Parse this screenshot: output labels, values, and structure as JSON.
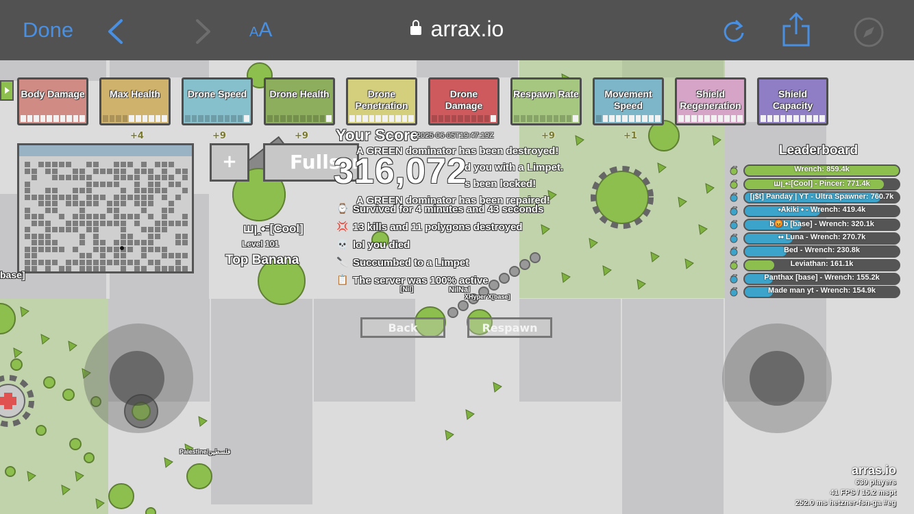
{
  "browser": {
    "done_label": "Done",
    "text_size_label_small": "A",
    "text_size_label_large": "A",
    "url": "arrax.io"
  },
  "upgrades": [
    {
      "label": "Body Damage",
      "color": "#d08b84",
      "filled": 0
    },
    {
      "label": "Max Health",
      "color": "#cfb26b",
      "filled": 4,
      "bonus": "+4"
    },
    {
      "label": "Drone Speed",
      "color": "#86c0cc",
      "filled": 9,
      "bonus": "+9"
    },
    {
      "label": "Drone Health",
      "color": "#8dae5c",
      "filled": 9,
      "bonus": "+9"
    },
    {
      "label": "Drone Penetration",
      "color": "#d4cf7d",
      "filled": 0
    },
    {
      "label": "Drone Damage",
      "color": "#cf5a5e",
      "filled": 9
    },
    {
      "label": "Respawn Rate",
      "color": "#a6c77f",
      "filled": 9,
      "bonus": "+9"
    },
    {
      "label": "Movement Speed",
      "color": "#7cb6c8",
      "filled": 1,
      "bonus": "+1"
    },
    {
      "label": "Shield Regeneration",
      "color": "#d5a4c7",
      "filled": 0
    },
    {
      "label": "Shield Capacity",
      "color": "#8f7dc6",
      "filled": 0
    }
  ],
  "hud": {
    "plus_label": "+",
    "fullscreen_label": "Fullscreen",
    "score_title": "Your Score",
    "score_value": "316,072",
    "timestamp": "2025-06-05T19:47:19Z",
    "player_name": "ꟺꞁꞈ⬩꞊[Cool]",
    "player_level": "Level 101",
    "player_title": "Top Banana"
  },
  "messages": [
    "A GREEN dominator has been destroyed!",
    "d you with a Limpet.",
    "s been locked!",
    "A GREEN dominator has been repaired!"
  ],
  "death_stats": [
    {
      "icon": "stopwatch-icon",
      "glyph": "⌚",
      "text": "Survived for 4 minutes and 43 seconds"
    },
    {
      "icon": "anger-icon",
      "glyph": "💢",
      "text": "13 kills and 11 polygons destroyed"
    },
    {
      "icon": "skull-icon",
      "glyph": "💀",
      "text": "lol you died"
    },
    {
      "icon": "knife-icon",
      "glyph": "🔪",
      "text": "Succumbed to a Limpet"
    },
    {
      "icon": "clipboard-icon",
      "glyph": "📋",
      "text": "The server was 100% active"
    }
  ],
  "buttons": {
    "back": "Back",
    "respawn": "Respawn"
  },
  "leaderboard": {
    "title": "Leaderboard",
    "entries": [
      {
        "name": "Wrench: 859.4k",
        "fill": 1.0,
        "color": "#8dbf4e"
      },
      {
        "name": "ꟺꞁꞈ⬩꞊[Cool] - Pincer: 771.4k",
        "fill": 0.9,
        "color": "#8dbf4e"
      },
      {
        "name": "[ꞁ$t] Panday | YT - Ultra Spawner: 760.7k",
        "fill": 0.88,
        "color": "#3ca4cb"
      },
      {
        "name": "⬩Akiki ⬩ - Wrench: 419.4k",
        "fill": 0.49,
        "color": "#3ca4cb"
      },
      {
        "name": "b😡b [base] - Wrench: 320.1k",
        "fill": 0.37,
        "color": "#3ca4cb"
      },
      {
        "name": "⬩⬩ Luna - Wrench: 270.7k",
        "fill": 0.31,
        "color": "#3ca4cb"
      },
      {
        "name": "Bed - Wrench: 230.8k",
        "fill": 0.27,
        "color": "#3ca4cb"
      },
      {
        "name": "Leviathan: 161.1k",
        "fill": 0.19,
        "color": "#8dbf4e"
      },
      {
        "name": "Panthax [base] - Wrench: 155.2k",
        "fill": 0.18,
        "color": "#3ca4cb"
      },
      {
        "name": "Made man yt - Wrench: 154.9k",
        "fill": 0.18,
        "color": "#3ca4cb"
      }
    ]
  },
  "server": {
    "name": "arras.io",
    "players": "639 players",
    "fps": "41 FPS / 15.2 mspt",
    "ping": "252.0 ms  hetzner-fsn-ga #eg"
  },
  "world_labels": {
    "left_edge": "base]",
    "nil_a": "[Nil]",
    "nil_b": "NilNal",
    "xhyper": "XHyper X[base]",
    "palestine": "Palestine/فلسطين"
  },
  "colors": {
    "green": "#8dbf4e",
    "blue": "#3ca4cb",
    "ios_blue": "#4a90e2",
    "toolbar": "#525252"
  }
}
